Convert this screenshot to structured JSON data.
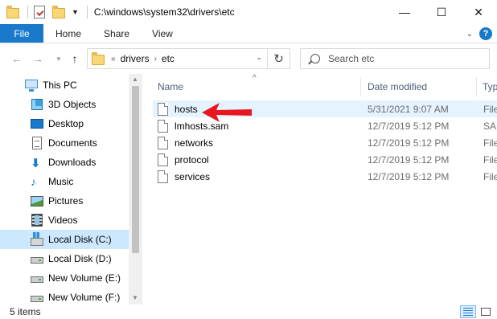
{
  "window": {
    "title": "C:\\windows\\system32\\drivers\\etc",
    "minimize_glyph": "—",
    "maximize_glyph": "☐",
    "close_glyph": "✕"
  },
  "ribbon": {
    "tabs": [
      {
        "label": "File"
      },
      {
        "label": "Home"
      },
      {
        "label": "Share"
      },
      {
        "label": "View"
      }
    ],
    "help_glyph": "?"
  },
  "address": {
    "overflow_glyph": "«",
    "crumbs": [
      "drivers",
      "etc"
    ],
    "separator_glyph": "›",
    "refresh_glyph": "↻"
  },
  "search": {
    "placeholder": "Search etc"
  },
  "nav_pane": {
    "items": [
      {
        "label": "This PC",
        "icon": "this-pc-icon"
      },
      {
        "label": "3D Objects",
        "icon": "3d-objects-icon"
      },
      {
        "label": "Desktop",
        "icon": "desktop-icon"
      },
      {
        "label": "Documents",
        "icon": "documents-icon"
      },
      {
        "label": "Downloads",
        "icon": "downloads-icon"
      },
      {
        "label": "Music",
        "icon": "music-icon"
      },
      {
        "label": "Pictures",
        "icon": "pictures-icon"
      },
      {
        "label": "Videos",
        "icon": "videos-icon"
      },
      {
        "label": "Local Disk (C:)",
        "icon": "system-drive-icon",
        "selected": true
      },
      {
        "label": "Local Disk (D:)",
        "icon": "drive-icon"
      },
      {
        "label": "New Volume (E:)",
        "icon": "drive-icon"
      },
      {
        "label": "New Volume (F:)",
        "icon": "drive-icon"
      }
    ]
  },
  "file_list": {
    "columns": {
      "name": "Name",
      "date_modified": "Date modified",
      "type": "Typ"
    },
    "files": [
      {
        "name": "hosts",
        "date": "5/31/2021 9:07 AM",
        "type": "File",
        "highlighted": true
      },
      {
        "name": "lmhosts.sam",
        "date": "12/7/2019 5:12 PM",
        "type": "SAM"
      },
      {
        "name": "networks",
        "date": "12/7/2019 5:12 PM",
        "type": "File"
      },
      {
        "name": "protocol",
        "date": "12/7/2019 5:12 PM",
        "type": "File"
      },
      {
        "name": "services",
        "date": "12/7/2019 5:12 PM",
        "type": "File"
      }
    ],
    "annotation_arrow_color": "#e8161e"
  },
  "status": {
    "item_count": "5 items"
  },
  "colors": {
    "accent": "#1979ca",
    "selection": "#cce8ff",
    "hover_row": "#e5f3ff"
  }
}
